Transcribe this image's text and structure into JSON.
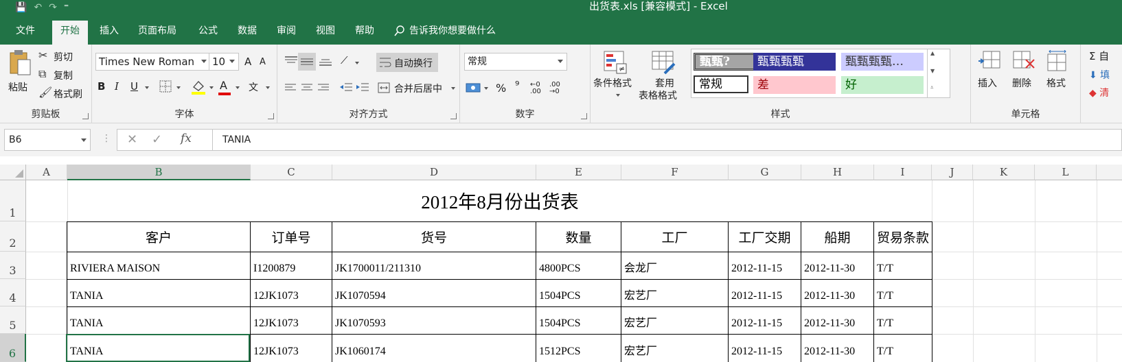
{
  "window": {
    "title": "出货表.xls  [兼容模式]  -  Excel"
  },
  "qat": {
    "save_glyph": "💾",
    "undo_glyph": "↶",
    "redo_glyph": "↷",
    "more_glyph": "⁼"
  },
  "tabs": [
    "文件",
    "开始",
    "插入",
    "页面布局",
    "公式",
    "数据",
    "审阅",
    "视图",
    "帮助"
  ],
  "tell_me": "告诉我你想要做什么",
  "ribbon": {
    "clipboard": {
      "paste": "粘贴",
      "cut": "剪切",
      "copy": "复制",
      "format_painter": "格式刷",
      "label": "剪贴板"
    },
    "font": {
      "name": "Times New Roman",
      "size": "10",
      "grow": "A",
      "shrink": "A",
      "bold": "B",
      "italic": "I",
      "underline": "U",
      "font_color": "A",
      "wen": "文",
      "label": "字体"
    },
    "alignment": {
      "wrap": "自动换行",
      "merge": "合并后居中",
      "label": "对齐方式"
    },
    "number": {
      "format": "常规",
      "percent": "%",
      "comma": "⁹",
      "label": "数字"
    },
    "styles": {
      "conditional": "条件格式",
      "table_format_1": "套用",
      "table_format_2": "表格格式",
      "cells": [
        "甄甄?",
        "甄甄甄甄",
        "甄甄甄甄…",
        "常规",
        "差",
        "好"
      ],
      "label": "样式"
    },
    "cells": {
      "insert": "插入",
      "delete": "删除",
      "format": "格式",
      "label": "单元格"
    },
    "editing": {
      "autosum": "Σ 自",
      "fill": "⬇ 填",
      "clear": "◆ 清"
    }
  },
  "formula_bar": {
    "name_box": "B6",
    "cancel": "✕",
    "enter": "✓",
    "fx": "fx",
    "value": "TANIA"
  },
  "columns": [
    "A",
    "B",
    "C",
    "D",
    "E",
    "F",
    "G",
    "H",
    "I",
    "J",
    "K",
    "L"
  ],
  "rows": [
    "1",
    "2",
    "3",
    "4",
    "5",
    "6"
  ],
  "sheet": {
    "title": "2012年8月份出货表",
    "headers": [
      "客户",
      "订单号",
      "货号",
      "数量",
      "工厂",
      "工厂交期",
      "船期",
      "贸易条款"
    ],
    "data": [
      [
        "RIVIERA MAISON",
        "I1200879",
        "JK1700011/211310",
        "4800PCS",
        "会龙厂",
        "2012-11-15",
        "2012-11-30",
        "T/T"
      ],
      [
        "TANIA",
        "12JK1073",
        "JK1070594",
        "1504PCS",
        "宏艺厂",
        "2012-11-15",
        "2012-11-30",
        "T/T"
      ],
      [
        "TANIA",
        "12JK1073",
        "JK1070593",
        "1504PCS",
        "宏艺厂",
        "2012-11-15",
        "2012-11-30",
        "T/T"
      ],
      [
        "TANIA",
        "12JK1073",
        "JK1060174",
        "1512PCS",
        "宏艺厂",
        "2012-11-15",
        "2012-11-30",
        "T/T"
      ]
    ]
  }
}
